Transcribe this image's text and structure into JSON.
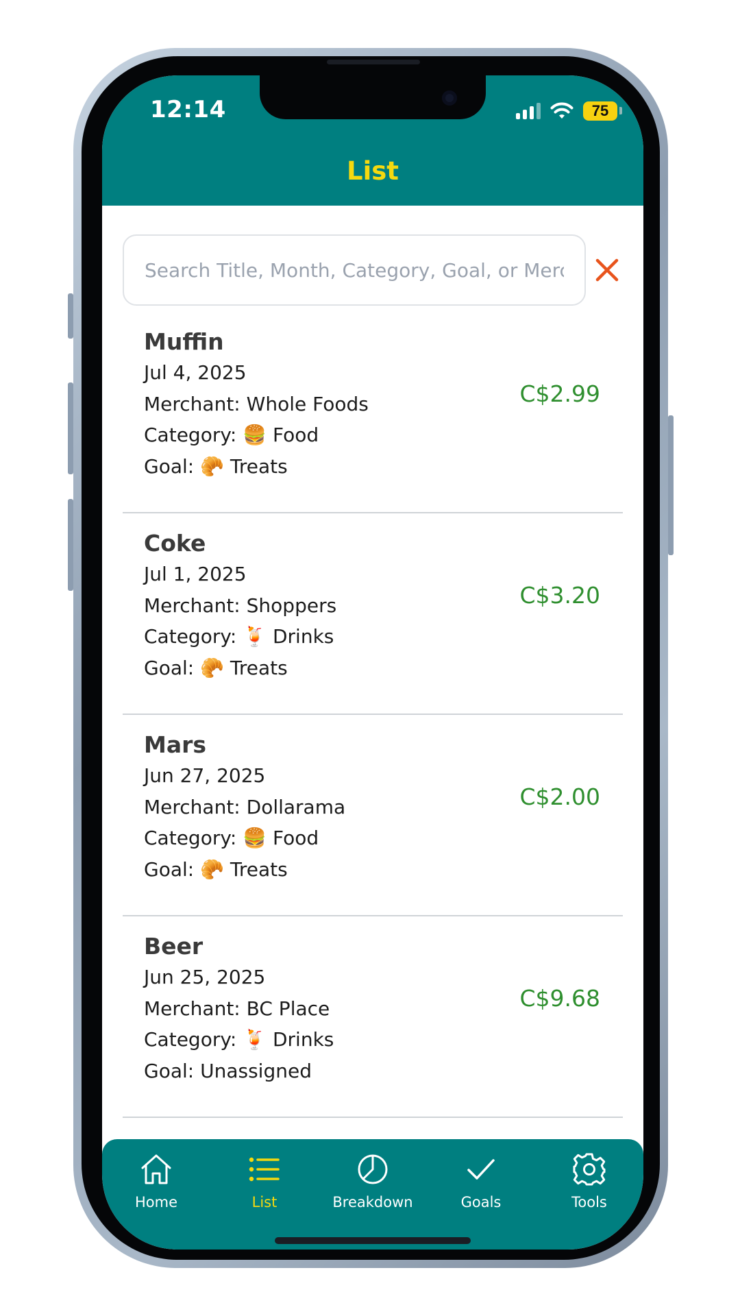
{
  "status_bar": {
    "time": "12:14",
    "battery": "75"
  },
  "header": {
    "title": "List"
  },
  "search": {
    "placeholder": "Search Title, Month, Category, Goal, or Merch"
  },
  "labels": {
    "merchant": "Merchant: ",
    "category": "Category: ",
    "goal": "Goal: "
  },
  "transactions": [
    {
      "title": "Muffin",
      "date": "Jul 4, 2025",
      "merchant": "Whole Foods",
      "category": "🍔 Food",
      "goal": "🥐 Treats",
      "amount": "C$2.99"
    },
    {
      "title": "Coke",
      "date": "Jul 1, 2025",
      "merchant": "Shoppers",
      "category": "🍹 Drinks",
      "goal": "🥐 Treats",
      "amount": "C$3.20"
    },
    {
      "title": "Mars",
      "date": "Jun 27, 2025",
      "merchant": "Dollarama",
      "category": "🍔 Food",
      "goal": "🥐 Treats",
      "amount": "C$2.00"
    },
    {
      "title": "Beer",
      "date": "Jun 25, 2025",
      "merchant": "BC Place",
      "category": "🍹 Drinks",
      "goal": "Unassigned",
      "amount": "C$9.68"
    }
  ],
  "tabs": [
    {
      "label": "Home",
      "icon": "home-icon"
    },
    {
      "label": "List",
      "icon": "list-icon",
      "active": true
    },
    {
      "label": "Breakdown",
      "icon": "pie-chart-icon"
    },
    {
      "label": "Goals",
      "icon": "check-icon"
    },
    {
      "label": "Tools",
      "icon": "gear-icon"
    }
  ],
  "colors": {
    "brand": "#007f80",
    "accent": "#f5d90f",
    "amount": "#2f8f2f",
    "clear": "#e8541c"
  }
}
